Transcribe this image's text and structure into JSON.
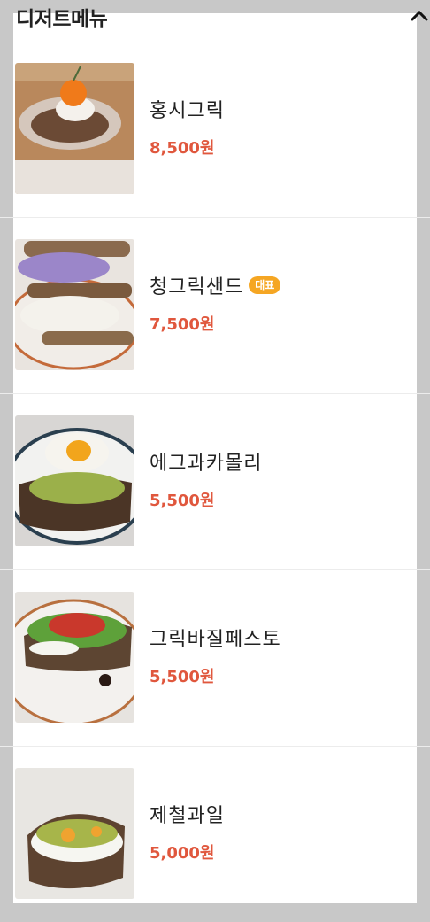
{
  "header": {
    "title": "디저트메뉴",
    "toggle_icon": "chevron-up-icon"
  },
  "items": [
    {
      "name": "홍시그릭",
      "price": "8,500원",
      "badge": ""
    },
    {
      "name": "청그릭샌드",
      "price": "7,500원",
      "badge": "대표"
    },
    {
      "name": "에그과카몰리",
      "price": "5,500원",
      "badge": ""
    },
    {
      "name": "그릭바질페스토",
      "price": "5,500원",
      "badge": ""
    },
    {
      "name": "제철과일",
      "price": "5,000원",
      "badge": ""
    }
  ],
  "colors": {
    "price": "#e0573d",
    "badge": "#f5a623"
  }
}
